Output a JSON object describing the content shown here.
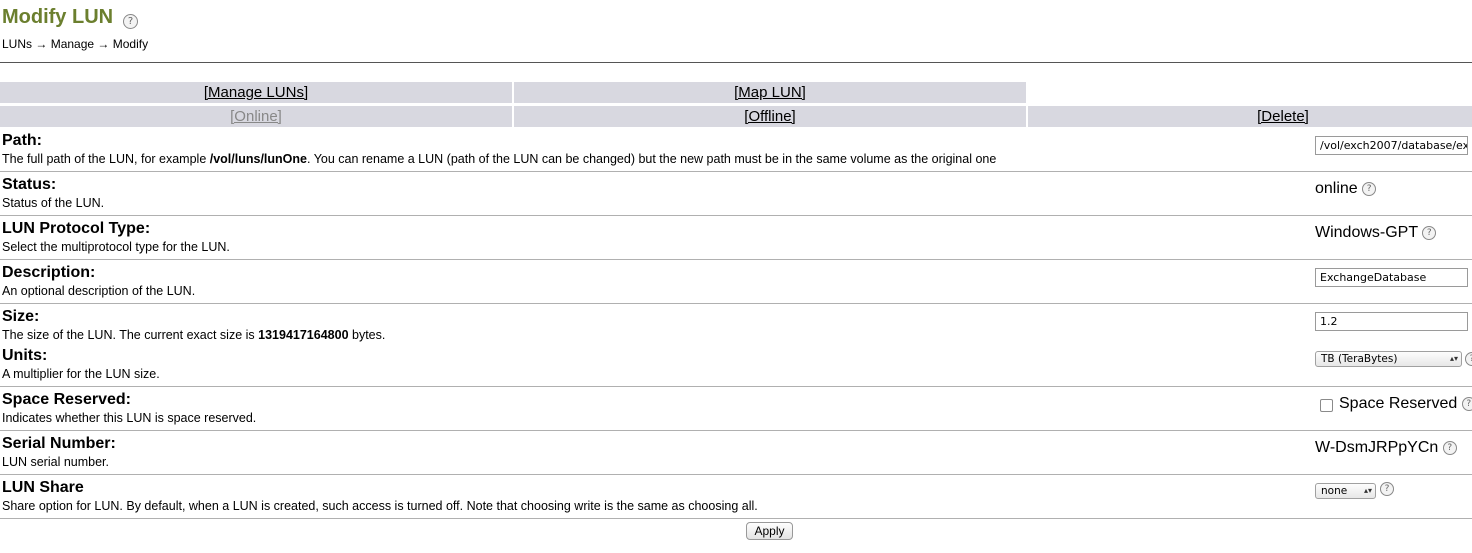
{
  "page": {
    "title": "Modify LUN",
    "breadcrumb": [
      "LUNs",
      "Manage",
      "Modify"
    ],
    "breadcrumb_separator": "→"
  },
  "nav": {
    "manage_luns": "[Manage LUNs]",
    "map_lun": "[Map LUN]",
    "online": "[Online]",
    "offline": "[Offline]",
    "delete": "[Delete]"
  },
  "fields": {
    "path": {
      "label": "Path:",
      "desc_pre": "The full path of the LUN, for example ",
      "desc_bold": "/vol/luns/lunOne",
      "desc_post": ". You can rename a LUN (path of the LUN can be changed) but the new path must be in the same volume as the original one",
      "value": "/vol/exch2007/database/ex"
    },
    "status": {
      "label": "Status:",
      "desc": "Status of the LUN.",
      "value": "online"
    },
    "protocol": {
      "label": "LUN Protocol Type:",
      "desc": "Select the multiprotocol type for the LUN.",
      "value": "Windows-GPT"
    },
    "description": {
      "label": "Description:",
      "desc": "An optional description of the LUN.",
      "value": "ExchangeDatabase"
    },
    "size": {
      "label": "Size:",
      "desc_pre": "The size of the LUN. The current exact size is ",
      "desc_bold": "1319417164800",
      "desc_post": " bytes.",
      "value": "1.2"
    },
    "units": {
      "label": "Units:",
      "desc": "A multiplier for the LUN size.",
      "value": "TB (TeraBytes)"
    },
    "space_reserved": {
      "label": "Space Reserved:",
      "desc": "Indicates whether this LUN is space reserved.",
      "checkbox_label": "Space Reserved",
      "checked": false
    },
    "serial": {
      "label": "Serial Number:",
      "desc": "LUN serial number.",
      "value": "W-DsmJRPpYCn"
    },
    "share": {
      "label": "LUN Share",
      "desc": "Share option for LUN. By default, when a LUN is created, such access is turned off. Note that choosing write is the same as choosing all.",
      "value": "none"
    }
  },
  "apply_label": "Apply",
  "help_glyph": "?",
  "colors": {
    "title": "#6b7f2e",
    "nav_bg": "#d8d8e0"
  }
}
